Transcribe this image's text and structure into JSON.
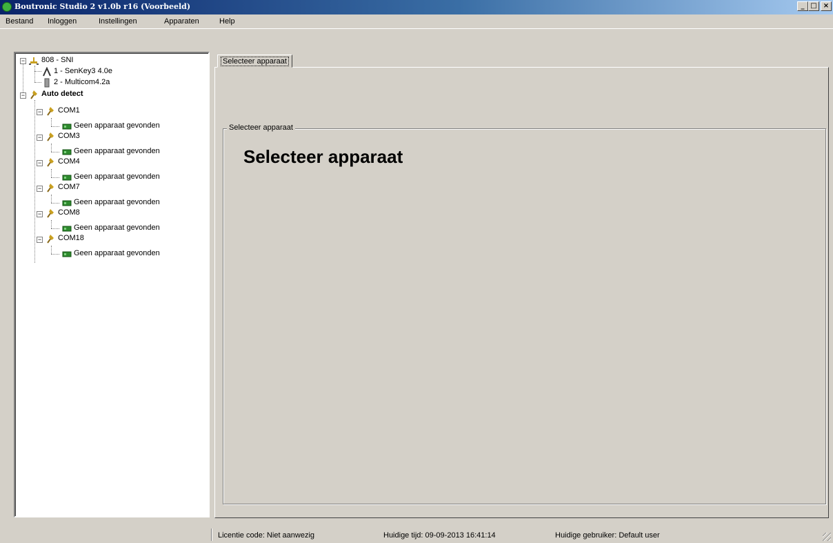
{
  "window": {
    "title": "Boutronic Studio 2 v1.0b r16 (Voorbeeld)",
    "minimize": "_",
    "maximize": "□",
    "close": "×"
  },
  "menu": [
    "Bestand",
    "Inloggen",
    "Instellingen",
    "Apparaten",
    "Help"
  ],
  "tree": {
    "root1": {
      "label": "808 - SNI",
      "children": [
        "1 - SenKey3 4.0e",
        "2 - Multicom4.2a"
      ]
    },
    "root2": {
      "label": "Auto detect",
      "ports": [
        {
          "label": "COM1",
          "child": "Geen apparaat gevonden"
        },
        {
          "label": "COM3",
          "child": "Geen apparaat gevonden"
        },
        {
          "label": "COM4",
          "child": "Geen apparaat gevonden"
        },
        {
          "label": "COM7",
          "child": "Geen apparaat gevonden"
        },
        {
          "label": "COM8",
          "child": "Geen apparaat gevonden"
        },
        {
          "label": "COM18",
          "child": "Geen apparaat gevonden"
        }
      ]
    }
  },
  "tab": {
    "label": "Selecteer apparaat"
  },
  "group": {
    "legend": "Selecteer apparaat",
    "heading": "Selecteer apparaat"
  },
  "status": {
    "license": "Licentie code: Niet aanwezig",
    "time": "Huidige tijd: 09-09-2013 16:41:14",
    "user": "Huidige gebruiker: Default user"
  },
  "colors": {
    "titlebar_start": "#0a246a",
    "titlebar_end": "#a6caf0",
    "face": "#d4d0c8",
    "device_icon": "#2e8b2e"
  }
}
